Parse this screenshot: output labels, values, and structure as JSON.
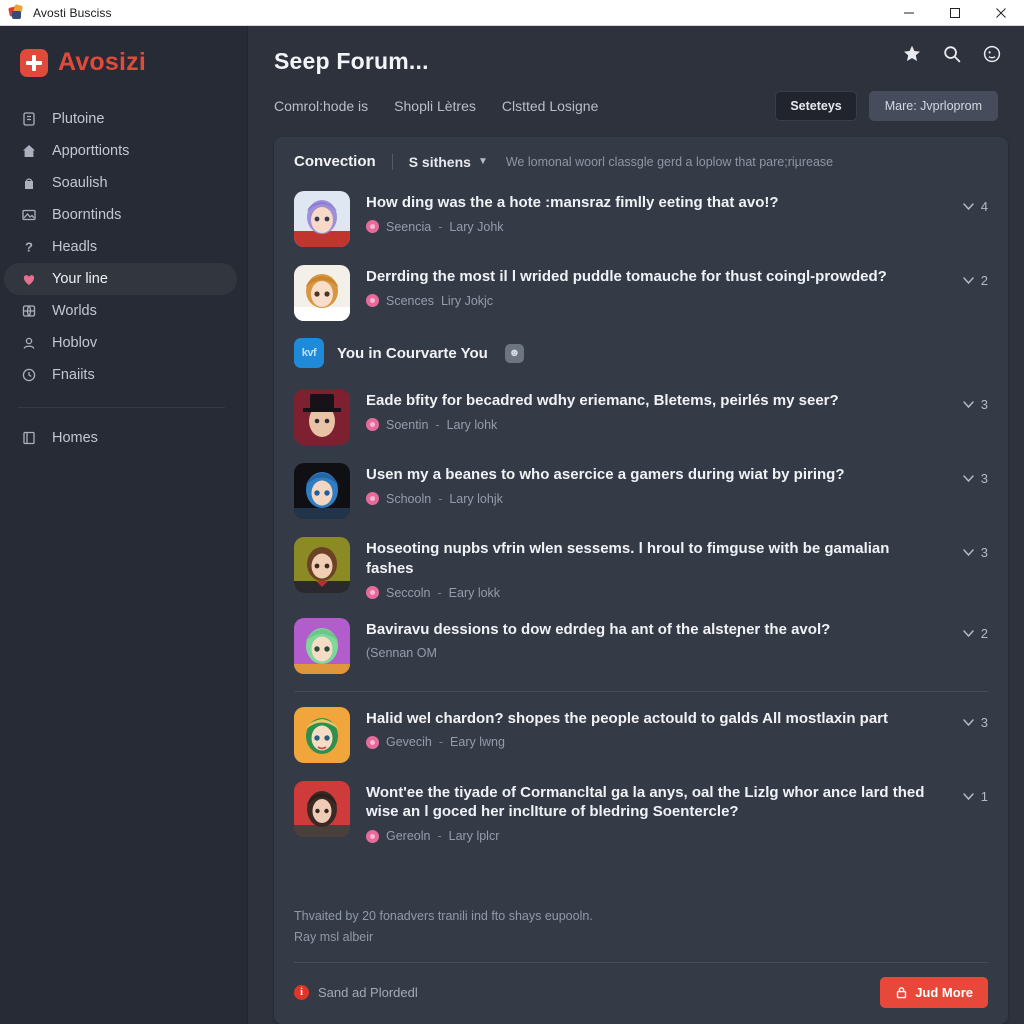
{
  "window": {
    "title": "Avosti Busciss",
    "app_icon": "app-logo-icon",
    "controls": {
      "minimize": "minimize-icon",
      "maximize": "maximize-icon",
      "close": "close-icon"
    }
  },
  "sidebar": {
    "brand": {
      "name": "Avosizi",
      "mark": "plus-badge-icon",
      "color": "#e04a3a"
    },
    "items": [
      {
        "label": "Plutoine",
        "icon": "clipboard-icon"
      },
      {
        "label": "Apporttionts",
        "icon": "home-icon"
      },
      {
        "label": "Soaulish",
        "icon": "bag-icon"
      },
      {
        "label": "Boorntinds",
        "icon": "image-icon"
      },
      {
        "label": "Headls",
        "icon": "question-icon"
      },
      {
        "label": "Your line",
        "icon": "heart-icon",
        "active": true
      },
      {
        "label": "Worlds",
        "icon": "globe-icon"
      },
      {
        "label": "Hoblov",
        "icon": "user-icon"
      },
      {
        "label": "Fnaiits",
        "icon": "clock-icon"
      }
    ],
    "footer_items": [
      {
        "label": "Homes",
        "icon": "book-icon"
      }
    ]
  },
  "header": {
    "title": "Seep Forum...",
    "tabs": [
      {
        "label": "Comrol:hode is"
      },
      {
        "label": "Shopli Lètres"
      },
      {
        "label": "Clstted Losigne"
      }
    ],
    "buttons": {
      "settings": "Seteteys",
      "primary": "Mare: Jvprloprom"
    },
    "icons": [
      {
        "name": "star-icon"
      },
      {
        "name": "search-icon"
      },
      {
        "name": "account-icon"
      }
    ]
  },
  "content": {
    "filter": {
      "title": "Convection",
      "selector": "S sithens",
      "caret": "chevron-down-icon",
      "note": "We lomonal woorl classgle gerd a loplow that pare;riµrease"
    },
    "threads": [
      {
        "title": "How ding was the a hote :mansraz fimlly eeting that avo!?",
        "author": "Seencia",
        "meta": "Lary Johk",
        "count": "4",
        "avatar": {
          "bg": "#dfe8f2",
          "hair": "#9d8fd8",
          "skin": "#f6d9c6",
          "cloth": "#c0362e"
        }
      },
      {
        "title": "Derrding the most il l wrided puddle tomauche for thust coingl-prowded?",
        "author": "Scences",
        "meta": "Liry Jokjc",
        "count": "2",
        "avatar": {
          "bg": "#f3efe9",
          "hair": "#d9963f",
          "skin": "#f8ddca",
          "cloth": "#ffffff"
        }
      },
      {
        "title": "Eade bfity for becadred wdhy eriemanc, Bletems, peirlés my seer?",
        "author": "Soentin",
        "meta": "Lary lohk",
        "count": "3",
        "avatar": {
          "bg": "#7d2030",
          "hair": "#2d2620",
          "skin": "#e9c3a6",
          "cloth": "#151318"
        }
      },
      {
        "title": "Usen my a beanes to who asercice a gamers during wiat by piring?",
        "author": "Schooln",
        "meta": "Lary lohjk",
        "count": "3",
        "avatar": {
          "bg": "#100f14",
          "hair": "#2f7ec4",
          "skin": "#f4d6c3",
          "cloth": "#22344a"
        }
      },
      {
        "title": "Hoseoting nupbs vfrin wlen sessems. l hroul to fimguse with be gamalian fashes",
        "author": "Seccoln",
        "meta": "Eary lokk",
        "count": "3",
        "avatar": {
          "bg": "#8c8a25",
          "hair": "#6a4226",
          "skin": "#f1cdb3",
          "cloth": "#2a2a2e"
        }
      },
      {
        "title": "Baviravu dessions to dow edrdeg ha ant of the alsteɲer the avol?",
        "author": "(Sennan OM",
        "meta": "",
        "count": "2",
        "avatar": {
          "bg": "#b35ccc",
          "hair": "#7fd79a",
          "skin": "#f6dcc7",
          "cloth": "#e0963a"
        }
      },
      {
        "title": "Halid wel chardon? shopes the people actould to galds All mostlaxin part",
        "author": "Gevecih",
        "meta": "Eary lwng",
        "count": "3",
        "divider_before": true,
        "avatar": {
          "bg": "#f0a63a",
          "hair": "#2f8f4e",
          "skin": "#f7dcc5",
          "cloth": "#e8c86a"
        }
      },
      {
        "title": "Wont'ee the tiyade of Cormancltal ga la anys, oal the Lizlg whor ance lard thed wise an l goced her inclIture of bledring Soentercle?",
        "author": "Gereoln",
        "meta": "Lary lplcr",
        "count": "1",
        "avatar": {
          "bg": "#cf3a3a",
          "hair": "#3a2a26",
          "skin": "#edcbb4",
          "cloth": "#4a3f3a"
        }
      }
    ],
    "promo": {
      "badge": "kvf",
      "text": "You in Courvarte You",
      "chip": "emoji-chip-icon"
    },
    "footer": {
      "note_line1": "Thvaited by 20 fonadvers tranili ind fto shays eupooln.",
      "note_line2": "Ray msl albeir",
      "status_icon": "info-icon",
      "status_text": "Sand ad Plordedl",
      "primary_button": {
        "label": "Jud More",
        "icon": "lock-icon",
        "color": "#e8483a"
      }
    }
  }
}
